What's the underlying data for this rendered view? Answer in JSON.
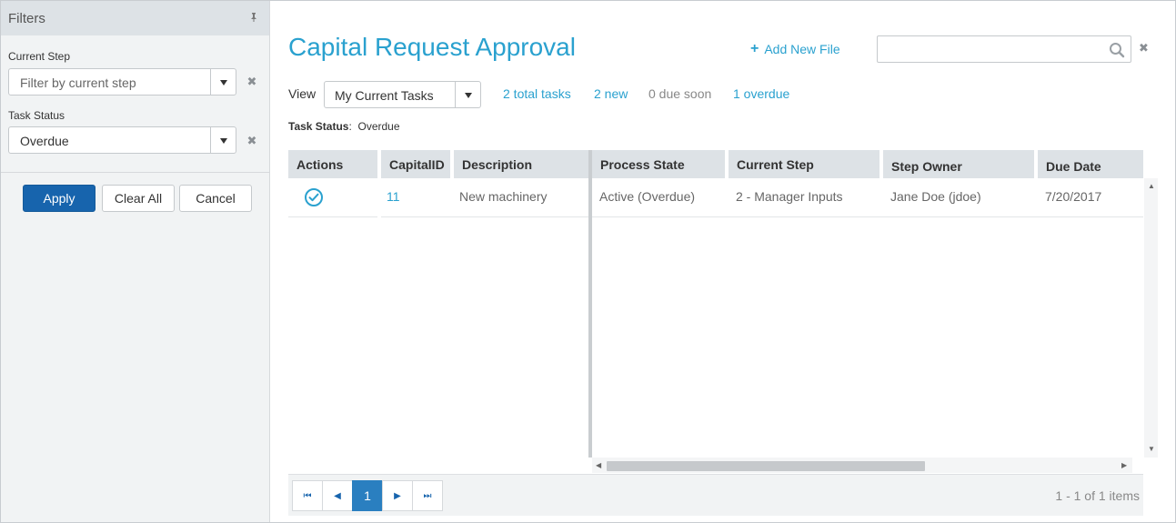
{
  "sidebar": {
    "title": "Filters",
    "current_step": {
      "label": "Current Step",
      "placeholder": "Filter by current step"
    },
    "task_status": {
      "label": "Task Status",
      "value": "Overdue"
    },
    "buttons": {
      "apply": "Apply",
      "clear_all": "Clear All",
      "cancel": "Cancel"
    }
  },
  "header": {
    "title": "Capital Request Approval",
    "add_file": "Add New File",
    "search_value": ""
  },
  "view": {
    "label": "View",
    "selected": "My Current Tasks",
    "stats": [
      "2 total tasks",
      "2 new",
      "0 due soon",
      "1 overdue"
    ]
  },
  "status_filter": {
    "label": "Task Status",
    "value": "Overdue"
  },
  "grid": {
    "columns": [
      "Actions",
      "CapitalID",
      "Description",
      "Process State",
      "Current Step",
      "Step Owner",
      "Due Date"
    ],
    "rows": [
      {
        "capital_id": "11",
        "description": "New machinery",
        "process_state": "Active (Overdue)",
        "current_step": "2 - Manager Inputs",
        "step_owner": "Jane Doe (jdoe)",
        "due_date": "7/20/2017"
      }
    ]
  },
  "pager": {
    "current_page": "1",
    "info": "1 - 1 of 1 items"
  },
  "colors": {
    "accent": "#2aa1cf",
    "primary_button": "#1764ad",
    "header_bg": "#dde2e6",
    "muted_stat": "#888888"
  },
  "icons": [
    "pin-icon",
    "close-icon",
    "chevron-down-icon",
    "plus-icon",
    "search-icon",
    "check-circle-icon",
    "first-page-icon",
    "prev-page-icon",
    "next-page-icon",
    "last-page-icon"
  ]
}
